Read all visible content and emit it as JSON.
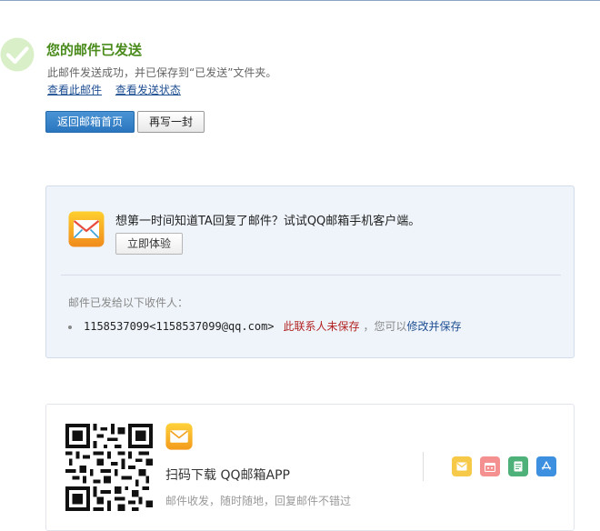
{
  "success": {
    "title": "您的邮件已发送",
    "description": "此邮件发送成功，并已保存到“已发送”文件夹。",
    "links": {
      "view_mail": "查看此邮件",
      "view_status": "查看发送状态"
    }
  },
  "buttons": {
    "back_home": "返回邮箱首页",
    "write_another": "再写一封"
  },
  "promo": {
    "text": "想第一时间知道TA回复了邮件？试试QQ邮箱手机客户端。",
    "try_button": "立即体验",
    "recipients_label": "邮件已发给以下收件人：",
    "recipient": {
      "email": "1158537099<1158537099@qq.com>",
      "status": "此联系人未保存",
      "hint_prefix": "，您可以",
      "hint_link": "修改并保存"
    }
  },
  "app": {
    "title": "扫码下载 QQ邮箱APP",
    "subtitle": "邮件收发，随时随地，回复邮件不错过"
  },
  "colors": {
    "success_green": "#4a8b1c",
    "link_blue": "#1e4e92",
    "warning_red": "#b22222",
    "primary_button": "#2a76bf"
  },
  "icons": {
    "success": "check-circle-icon",
    "mail": "qqmail-envelope-icon",
    "mini": [
      "note-icon",
      "calendar-icon",
      "document-icon",
      "app-store-icon"
    ]
  }
}
